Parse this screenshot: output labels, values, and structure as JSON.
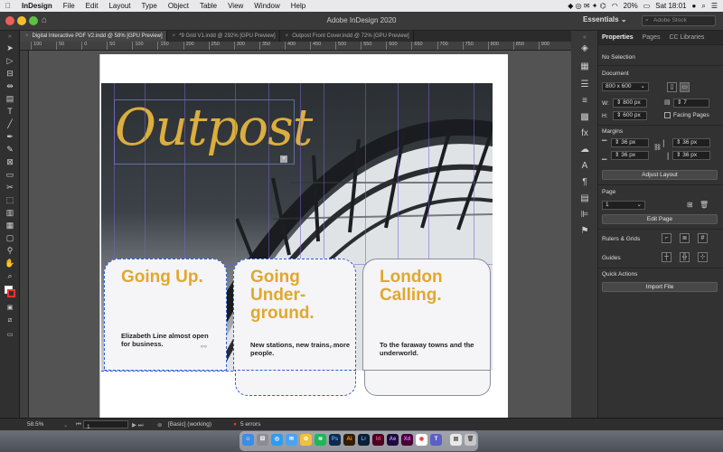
{
  "menubar": {
    "apple": "",
    "app": "InDesign",
    "items": [
      "File",
      "Edit",
      "Layout",
      "Type",
      "Object",
      "Table",
      "View",
      "Window",
      "Help"
    ],
    "battery": "20%",
    "clock": "Sat 18:01"
  },
  "header": {
    "title": "Adobe InDesign 2020",
    "workspace": "Essentials",
    "search_placeholder": "Adobe Stock"
  },
  "tabs": [
    {
      "label": "Digital Interactive PDF V2.indd @ 58% [GPU Preview]"
    },
    {
      "label": "*9 Grid V1.indd @ 292% [GPU Preview]"
    },
    {
      "label": "Outpost Front Cover.indd @ 72% [GPU Preview]"
    }
  ],
  "ruler": {
    "ticks": [
      "100",
      "50",
      "0",
      "50",
      "100",
      "150",
      "200",
      "250",
      "300",
      "350",
      "400",
      "450",
      "500",
      "550",
      "600",
      "650",
      "700",
      "750",
      "800",
      "850",
      "900"
    ]
  },
  "cover": {
    "logo": "Outpost",
    "cards": [
      {
        "head": "Going Up.",
        "body": "Elizabeth Line almost open for business."
      },
      {
        "head": "Going Under-ground.",
        "body": "New stations, new trains, more people."
      },
      {
        "head": "London Calling.",
        "body": "To the faraway towns and the underworld."
      }
    ]
  },
  "properties": {
    "tabs": [
      "Properties",
      "Pages",
      "CC Libraries"
    ],
    "selection": "No Selection",
    "document_label": "Document",
    "preset": "800 x 600",
    "w_label": "W:",
    "w": "800 px",
    "h_label": "H:",
    "h": "600 px",
    "pages_count": "7",
    "facing_pages": "Facing Pages",
    "margins_label": "Margins",
    "margin_top": "36 px",
    "margin_bottom": "36 px",
    "margin_left": "36 px",
    "margin_right": "36 px",
    "adjust_layout": "Adjust Layout",
    "page_label": "Page",
    "page_value": "1",
    "edit_page": "Edit Page",
    "rulers_grids": "Rulers & Grids",
    "guides": "Guides",
    "quick_actions": "Quick Actions",
    "import_file": "Import File"
  },
  "status": {
    "zoom": "58.5%",
    "page": "1",
    "style": "[Basic] (working)",
    "errors": "5 errors"
  },
  "dock": {
    "apps": [
      "Finder",
      "Launchpad",
      "Safari",
      "Mail",
      "Photos",
      "Spotify",
      "Ps",
      "Ai",
      "Lr",
      "Id",
      "Ae",
      "Xd",
      "Chrome",
      "Teams",
      "Notes",
      "Trash"
    ]
  }
}
